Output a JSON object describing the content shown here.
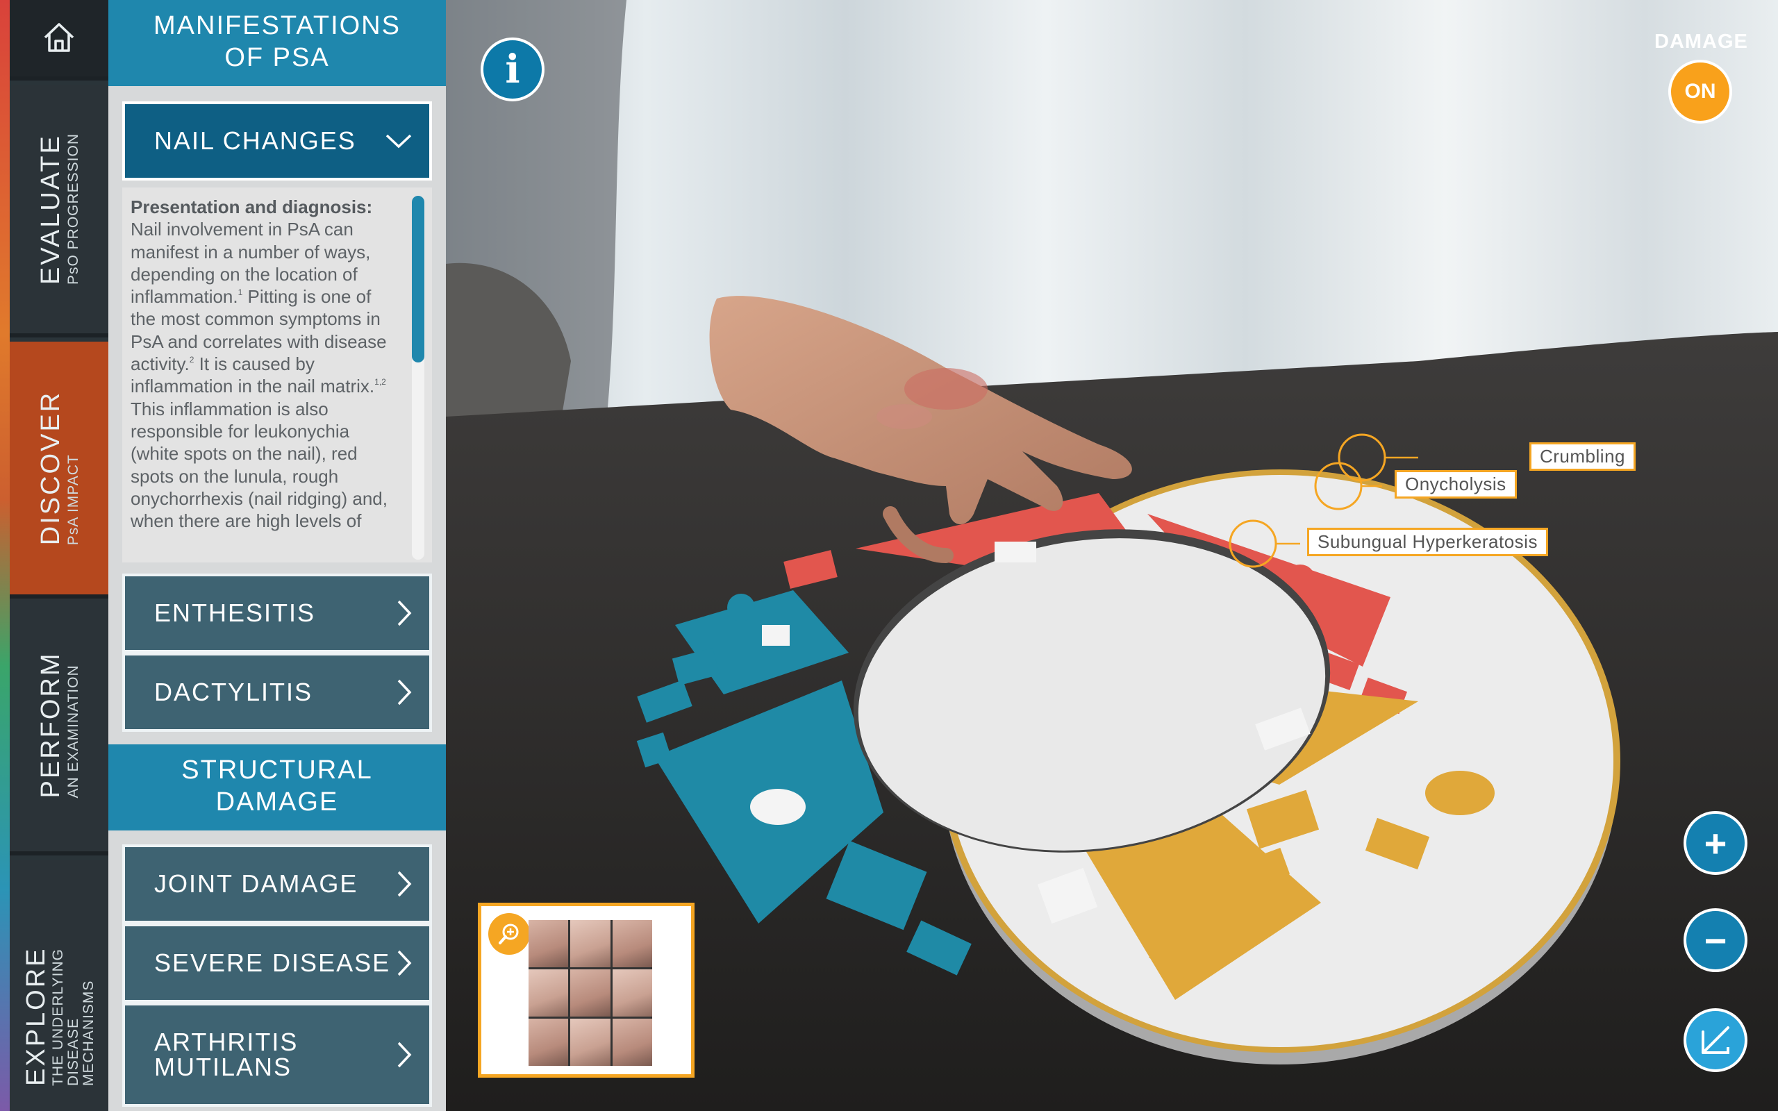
{
  "nav": {
    "items": [
      {
        "title": "EVALUATE",
        "subtitle": "PsO PROGRESSION"
      },
      {
        "title": "DISCOVER",
        "subtitle": "PsA IMPACT"
      },
      {
        "title": "PERFORM",
        "subtitle": "AN EXAMINATION"
      },
      {
        "title": "EXPLORE",
        "subtitle": "THE UNDERLYING DISEASE MECHANISMS"
      }
    ],
    "active": "DISCOVER"
  },
  "panel": {
    "section1_title": "MANIFESTATIONS OF PSA",
    "open_item": "NAIL CHANGES",
    "description_heading": "Presentation and diagnosis:",
    "description_body": [
      {
        "text": " Nail involvement in PsA can manifest in a number of ways, depending on the location of inflammation.",
        "sup": "1"
      },
      {
        "text": " Pitting is one of the most common symptoms in PsA and correlates with disease activity.",
        "sup": "2"
      },
      {
        "text": " It is caused by inflammation in the nail matrix.",
        "sup": "1,2"
      },
      {
        "text": " This inflammation is also responsible for leukonychia (white spots on the nail), red spots on the lunula, rough onychorrhexis (nail ridging)  and, when there are high levels of",
        "sup": ""
      }
    ],
    "items1": [
      "ENTHESITIS",
      "DACTYLITIS"
    ],
    "section2_title": "STRUCTURAL DAMAGE",
    "items2": [
      "JOINT DAMAGE",
      "SEVERE DISEASE",
      "ARTHRITIS MUTILANS"
    ]
  },
  "scene": {
    "info_icon": "i",
    "damage_label": "DAMAGE",
    "damage_state": "ON",
    "labels": [
      "Crumbling",
      "Onycholysis",
      "Subungual Hyperkeratosis"
    ],
    "zoom_controls": {
      "plus": "+",
      "minus": "−"
    }
  },
  "icons": [
    "home-icon",
    "chevron-down-icon",
    "chevron-right-icon",
    "info-icon",
    "zoom-in-icon",
    "plus-icon",
    "minus-icon",
    "resize-icon"
  ],
  "colors": {
    "accent": "#1f87ad",
    "active_nav": "#b5481e",
    "highlight": "#f5a623",
    "red": "#e2564e",
    "teal": "#1f8aa6",
    "yellow": "#e0a83a"
  }
}
